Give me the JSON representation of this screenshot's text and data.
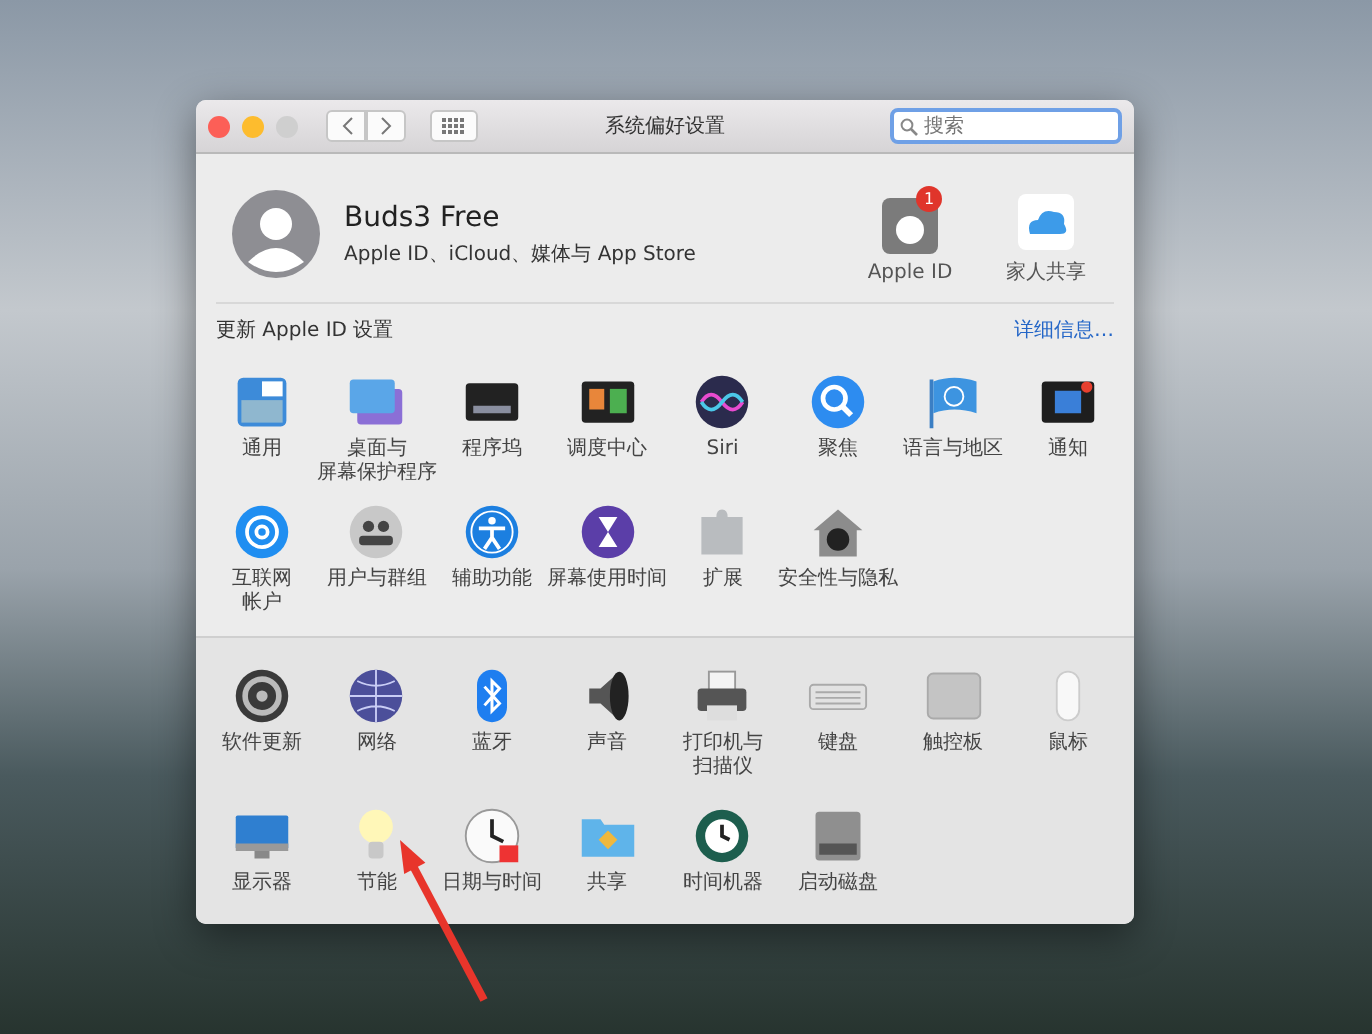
{
  "window": {
    "title": "系统偏好设置",
    "search": {
      "placeholder": "搜索"
    }
  },
  "account": {
    "name": "Buds3 Free",
    "subtitle": "Apple ID、iCloud、媒体与 App Store"
  },
  "account_items": [
    {
      "label": "Apple ID",
      "badge": "1"
    },
    {
      "label": "家人共享"
    }
  ],
  "notice": {
    "text": "更新 Apple ID 设置",
    "link": "详细信息…"
  },
  "sections": [
    {
      "items": [
        {
          "lines": [
            "通用"
          ]
        },
        {
          "lines": [
            "桌面与",
            "屏幕保护程序"
          ]
        },
        {
          "lines": [
            "程序坞"
          ]
        },
        {
          "lines": [
            "调度中心"
          ]
        },
        {
          "lines": [
            "Siri"
          ]
        },
        {
          "lines": [
            "聚焦"
          ]
        },
        {
          "lines": [
            "语言与地区"
          ]
        },
        {
          "lines": [
            "通知"
          ]
        },
        {
          "lines": [
            "互联网",
            "帐户"
          ]
        },
        {
          "lines": [
            "用户与群组"
          ]
        },
        {
          "lines": [
            "辅助功能"
          ]
        },
        {
          "lines": [
            "屏幕使用时间"
          ]
        },
        {
          "lines": [
            "扩展"
          ]
        },
        {
          "lines": [
            "安全性与隐私"
          ]
        }
      ]
    },
    {
      "items": [
        {
          "lines": [
            "软件更新"
          ]
        },
        {
          "lines": [
            "网络"
          ]
        },
        {
          "lines": [
            "蓝牙"
          ]
        },
        {
          "lines": [
            "声音"
          ]
        },
        {
          "lines": [
            "打印机与",
            "扫描仪"
          ]
        },
        {
          "lines": [
            "键盘"
          ]
        },
        {
          "lines": [
            "触控板"
          ]
        },
        {
          "lines": [
            "鼠标"
          ]
        },
        {
          "lines": [
            "显示器"
          ]
        },
        {
          "lines": [
            "节能"
          ]
        },
        {
          "lines": [
            "日期与时间"
          ]
        },
        {
          "lines": [
            "共享"
          ]
        },
        {
          "lines": [
            "时间机器"
          ]
        },
        {
          "lines": [
            "启动磁盘"
          ]
        }
      ]
    }
  ]
}
